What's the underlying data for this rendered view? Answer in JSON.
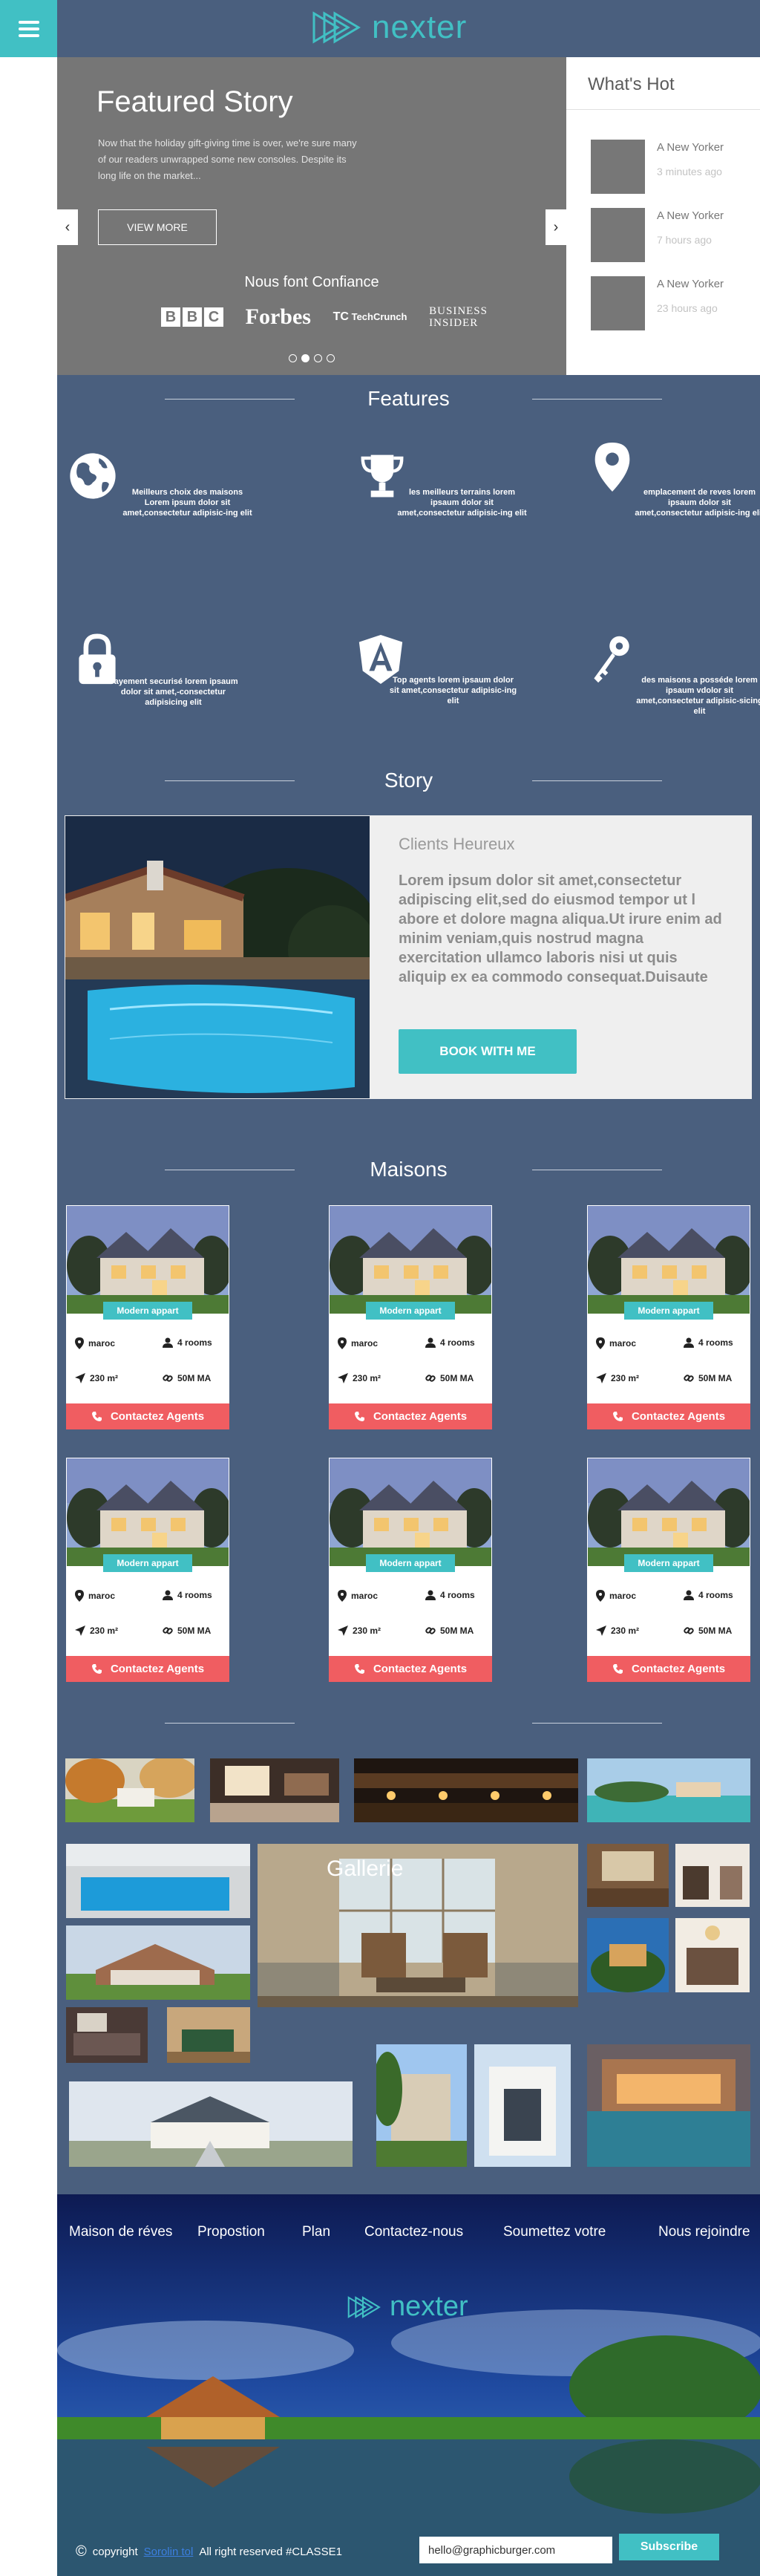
{
  "header": {
    "logo_text": "nexter",
    "menu_icon": "hamburger-menu-icon"
  },
  "hero": {
    "title": "Featured Story",
    "text": "Now that the holiday gift-giving time is over, we're sure many of our readers unwrapped some new consoles. Despite its long life on the market...",
    "button_label": "VIEW MORE",
    "trust_title": "Nous font Confiance",
    "brands": {
      "bbc": [
        "B",
        "B",
        "C"
      ],
      "forbes": "Forbes",
      "techcrunch": "TechCrunch",
      "business_insider_line1": "BUSINESS",
      "business_insider_line2": "INSIDER"
    },
    "prev_arrow": "‹",
    "next_arrow": "›"
  },
  "whats_hot": {
    "title": "What's Hot",
    "items": [
      {
        "name": "A New Yorker",
        "time": "3 minutes ago"
      },
      {
        "name": "A New Yorker",
        "time": "7 hours ago"
      },
      {
        "name": "A New Yorker",
        "time": "23 hours ago"
      }
    ]
  },
  "features": {
    "title": "Features",
    "items": [
      {
        "icon": "globe-icon",
        "text": "Meilleurs choix des maisons Lorem ipsum dolor sit amet,consectetur adipisic-ing elit"
      },
      {
        "icon": "trophy-icon",
        "text": "les meilleurs terrains lorem ipsaum dolor sit amet,consectetur adipisic-ing elit"
      },
      {
        "icon": "map-pin-icon",
        "text": "emplacement de reves lorem ipsaum dolor sit amet,consectetur adipisic-ing elit"
      },
      {
        "icon": "lock-icon",
        "text": "Payement securisé lorem ipsaum dolor sit amet,-consectetur adipisicing elit"
      },
      {
        "icon": "angular-icon",
        "text": "Top agents lorem ipsaum dolor sit amet,consectetur adipisic-ing elit"
      },
      {
        "icon": "key-icon",
        "text": "des maisons a posséde lorem ipsaum vdolor sit amet,consectetur adipisic-sicing elit"
      }
    ]
  },
  "story": {
    "title": "Story",
    "subtitle": "Clients Heureux",
    "text": "Lorem ipsum dolor sit amet,consectetur adipiscing elit,sed do eiusmod tempor ut l abore et dolore magna aliqua.Ut irure enim ad minim veniam,quis nostrud magna exercitation ullamco laboris nisi ut quis aliquip ex ea commodo consequat.Duisaute",
    "button_label": "BOOK WITH ME"
  },
  "maisons": {
    "title": "Maisons",
    "cards": [
      {
        "tag": "Modern appart",
        "location": "maroc",
        "rooms": "4 rooms",
        "area": "230 m²",
        "price": "50M MA",
        "cta": "Contactez Agents"
      },
      {
        "tag": "Modern appart",
        "location": "maroc",
        "rooms": "4 rooms",
        "area": "230 m²",
        "price": "50M MA",
        "cta": "Contactez Agents"
      },
      {
        "tag": "Modern appart",
        "location": "maroc",
        "rooms": "4 rooms",
        "area": "230 m²",
        "price": "50M MA",
        "cta": "Contactez Agents"
      },
      {
        "tag": "Modern appart",
        "location": "maroc",
        "rooms": "4 rooms",
        "area": "230 m²",
        "price": "50M MA",
        "cta": "Contactez Agents"
      },
      {
        "tag": "Modern appart",
        "location": "maroc",
        "rooms": "4 rooms",
        "area": "230 m²",
        "price": "50M MA",
        "cta": "Contactez Agents"
      },
      {
        "tag": "Modern appart",
        "location": "maroc",
        "rooms": "4 rooms",
        "area": "230 m²",
        "price": "50M MA",
        "cta": "Contactez Agents"
      }
    ]
  },
  "gallery": {
    "title": "Gallerie"
  },
  "footer": {
    "nav": [
      "Maison de réves",
      "Propostion",
      "Plan",
      "Contactez-nous",
      "Soumettez votre",
      "Nous rejoindre"
    ],
    "logo_text": "nexter",
    "copyright_symbol": "©",
    "copyright_label": "copyright",
    "copyright_link": "Sorolin tol",
    "copyright_rest": "All right reserved #CLASSE1",
    "email_value": "hello@graphicburger.com",
    "subscribe_label": "Subscribe"
  },
  "colors": {
    "accent": "#41c0c4",
    "background": "#4a5f7e",
    "cta_red": "#f05d61",
    "hero_gray": "#767676"
  }
}
